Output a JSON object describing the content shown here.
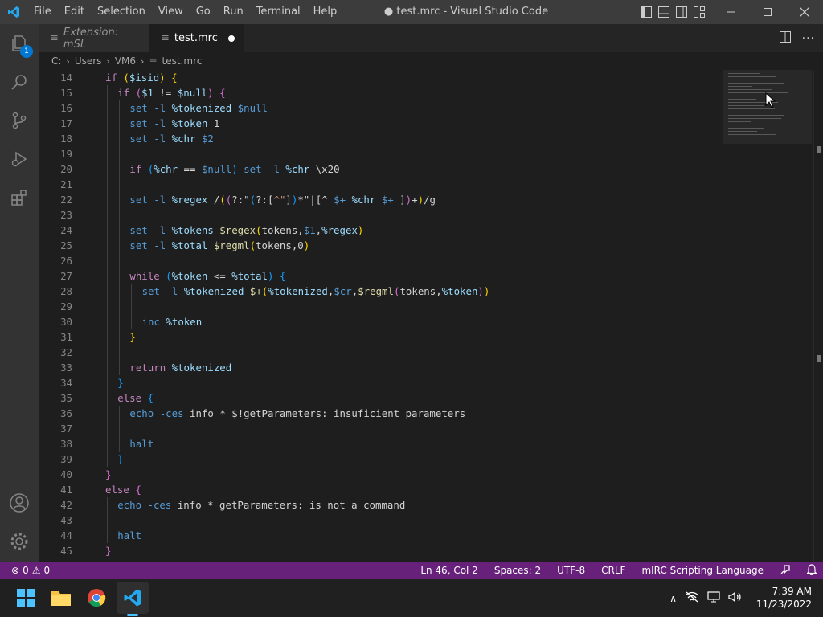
{
  "titlebar": {
    "menu": [
      "File",
      "Edit",
      "Selection",
      "View",
      "Go",
      "Run",
      "Terminal",
      "Help"
    ],
    "title": "● test.mrc - Visual Studio Code"
  },
  "activity": {
    "explorer_badge": "1"
  },
  "tabs": [
    {
      "label": "Extension: mSL",
      "active": false
    },
    {
      "label": "test.mrc",
      "active": true
    }
  ],
  "breadcrumb": [
    "C:",
    "Users",
    "VM6",
    "test.mrc"
  ],
  "editor": {
    "lines": [
      {
        "n": "14",
        "indent": 1,
        "tokens": [
          [
            "kw",
            "if "
          ],
          [
            "br1",
            "("
          ],
          [
            "var",
            "$isid"
          ],
          [
            "br1",
            ")"
          ],
          [
            "plain",
            " "
          ],
          [
            "br1",
            "{"
          ]
        ]
      },
      {
        "n": "15",
        "indent": 2,
        "tokens": [
          [
            "kw",
            "if "
          ],
          [
            "br2",
            "("
          ],
          [
            "var",
            "$1"
          ],
          [
            "plain",
            " != "
          ],
          [
            "var",
            "$null"
          ],
          [
            "br2",
            ")"
          ],
          [
            "plain",
            " "
          ],
          [
            "br2",
            "{"
          ]
        ]
      },
      {
        "n": "16",
        "indent": 3,
        "tokens": [
          [
            "id",
            "set -l "
          ],
          [
            "var",
            "%tokenized "
          ],
          [
            "id",
            "$null"
          ]
        ]
      },
      {
        "n": "17",
        "indent": 3,
        "tokens": [
          [
            "id",
            "set -l "
          ],
          [
            "var",
            "%token "
          ],
          [
            "plain",
            "1"
          ]
        ]
      },
      {
        "n": "18",
        "indent": 3,
        "tokens": [
          [
            "id",
            "set -l "
          ],
          [
            "var",
            "%chr "
          ],
          [
            "id",
            "$2"
          ]
        ]
      },
      {
        "n": "19",
        "indent": 3,
        "tokens": []
      },
      {
        "n": "20",
        "indent": 3,
        "tokens": [
          [
            "kw",
            "if "
          ],
          [
            "br3",
            "("
          ],
          [
            "var",
            "%chr"
          ],
          [
            "plain",
            " == "
          ],
          [
            "id",
            "$null"
          ],
          [
            "br3",
            ")"
          ],
          [
            "plain",
            " "
          ],
          [
            "id",
            "set -l "
          ],
          [
            "var",
            "%chr "
          ],
          [
            "plain",
            "\\x20"
          ]
        ]
      },
      {
        "n": "21",
        "indent": 3,
        "tokens": []
      },
      {
        "n": "22",
        "indent": 3,
        "tokens": [
          [
            "id",
            "set -l "
          ],
          [
            "var",
            "%regex "
          ],
          [
            "plain",
            "/"
          ],
          [
            "br1",
            "("
          ],
          [
            "br2",
            "("
          ],
          [
            "plain",
            "?:\""
          ],
          [
            "br3",
            "("
          ],
          [
            "plain",
            "?:["
          ],
          [
            "str",
            "^\""
          ],
          [
            "plain",
            "]"
          ],
          [
            "br3",
            ")"
          ],
          [
            "plain",
            "*\"|[^ "
          ],
          [
            "id",
            "$+ "
          ],
          [
            "var",
            "%chr "
          ],
          [
            "id",
            "$+ "
          ],
          [
            "plain",
            "]"
          ],
          [
            "br2",
            ")"
          ],
          [
            "plain",
            "+"
          ],
          [
            "br1",
            ")"
          ],
          [
            "plain",
            "/g"
          ]
        ]
      },
      {
        "n": "23",
        "indent": 3,
        "tokens": []
      },
      {
        "n": "24",
        "indent": 3,
        "tokens": [
          [
            "id",
            "set -l "
          ],
          [
            "var",
            "%tokens "
          ],
          [
            "fn",
            "$regex"
          ],
          [
            "br1",
            "("
          ],
          [
            "plain",
            "tokens,"
          ],
          [
            "id",
            "$1"
          ],
          [
            "plain",
            ","
          ],
          [
            "var",
            "%regex"
          ],
          [
            "br1",
            ")"
          ]
        ]
      },
      {
        "n": "25",
        "indent": 3,
        "tokens": [
          [
            "id",
            "set -l "
          ],
          [
            "var",
            "%total "
          ],
          [
            "fn",
            "$regml"
          ],
          [
            "br1",
            "("
          ],
          [
            "plain",
            "tokens,0"
          ],
          [
            "br1",
            ")"
          ]
        ]
      },
      {
        "n": "26",
        "indent": 3,
        "tokens": []
      },
      {
        "n": "27",
        "indent": 3,
        "tokens": [
          [
            "kw",
            "while "
          ],
          [
            "br3",
            "("
          ],
          [
            "var",
            "%token"
          ],
          [
            "plain",
            " <= "
          ],
          [
            "var",
            "%total"
          ],
          [
            "br3",
            ")"
          ],
          [
            "plain",
            " "
          ],
          [
            "br3",
            "{"
          ]
        ]
      },
      {
        "n": "28",
        "indent": 4,
        "tokens": [
          [
            "id",
            "set -l "
          ],
          [
            "var",
            "%tokenized "
          ],
          [
            "fn",
            "$+"
          ],
          [
            "br1",
            "("
          ],
          [
            "var",
            "%tokenized"
          ],
          [
            "plain",
            ","
          ],
          [
            "id",
            "$cr"
          ],
          [
            "plain",
            ","
          ],
          [
            "fn",
            "$regml"
          ],
          [
            "br2",
            "("
          ],
          [
            "plain",
            "tokens,"
          ],
          [
            "var",
            "%token"
          ],
          [
            "br2",
            ")"
          ],
          [
            "br1",
            ")"
          ]
        ]
      },
      {
        "n": "29",
        "indent": 4,
        "tokens": []
      },
      {
        "n": "30",
        "indent": 4,
        "tokens": [
          [
            "id",
            "inc "
          ],
          [
            "var",
            "%token"
          ]
        ]
      },
      {
        "n": "31",
        "indent": 3,
        "tokens": [
          [
            "br1",
            "}"
          ]
        ]
      },
      {
        "n": "32",
        "indent": 3,
        "tokens": []
      },
      {
        "n": "33",
        "indent": 3,
        "tokens": [
          [
            "kw",
            "return "
          ],
          [
            "var",
            "%tokenized"
          ]
        ]
      },
      {
        "n": "34",
        "indent": 2,
        "tokens": [
          [
            "br3",
            "}"
          ]
        ]
      },
      {
        "n": "35",
        "indent": 2,
        "tokens": [
          [
            "kw",
            "else "
          ],
          [
            "br3",
            "{"
          ]
        ]
      },
      {
        "n": "36",
        "indent": 3,
        "tokens": [
          [
            "id",
            "echo "
          ],
          [
            "id",
            "-ces "
          ],
          [
            "plain",
            "info * $!getParameters: insuficient parameters"
          ]
        ]
      },
      {
        "n": "37",
        "indent": 3,
        "tokens": []
      },
      {
        "n": "38",
        "indent": 3,
        "tokens": [
          [
            "id",
            "halt"
          ]
        ]
      },
      {
        "n": "39",
        "indent": 2,
        "tokens": [
          [
            "br3",
            "}"
          ]
        ]
      },
      {
        "n": "40",
        "indent": 1,
        "tokens": [
          [
            "br2",
            "}"
          ]
        ]
      },
      {
        "n": "41",
        "indent": 1,
        "tokens": [
          [
            "kw",
            "else "
          ],
          [
            "br2",
            "{"
          ]
        ]
      },
      {
        "n": "42",
        "indent": 2,
        "tokens": [
          [
            "id",
            "echo "
          ],
          [
            "id",
            "-ces "
          ],
          [
            "plain",
            "info * getParameters: is not a command"
          ]
        ]
      },
      {
        "n": "43",
        "indent": 2,
        "tokens": []
      },
      {
        "n": "44",
        "indent": 2,
        "tokens": [
          [
            "id",
            "halt"
          ]
        ]
      },
      {
        "n": "45",
        "indent": 1,
        "tokens": [
          [
            "br2",
            "}"
          ]
        ]
      }
    ]
  },
  "statusbar": {
    "errors": "0",
    "warnings": "0",
    "position": "Ln 46, Col 2",
    "spaces": "Spaces: 2",
    "encoding": "UTF-8",
    "eol": "CRLF",
    "language": "mIRC Scripting Language"
  },
  "taskbar": {
    "time": "7:39 AM",
    "date": "11/23/2022"
  },
  "colors": {
    "statusbar": "#68217a",
    "accent": "#0078d4"
  }
}
